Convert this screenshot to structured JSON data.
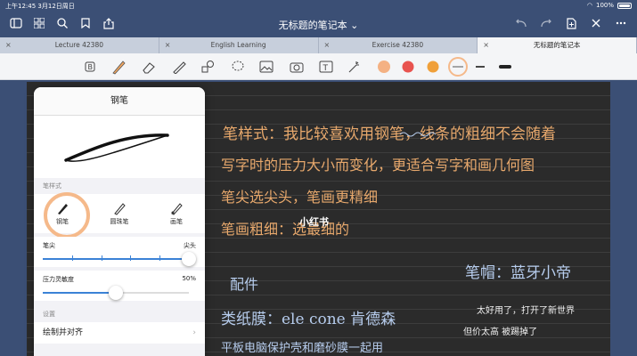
{
  "status": {
    "time": "上午12:45",
    "date": "3月12日周日",
    "battery": "100%"
  },
  "nav": {
    "title": "无标题的笔记本 ⌄"
  },
  "tabs": [
    {
      "label": "Lecture 42380"
    },
    {
      "label": "English Learning"
    },
    {
      "label": "Exercise 42380"
    },
    {
      "label": "无标题的笔记本"
    }
  ],
  "toolbar": {
    "colors": [
      "#f4b183",
      "#e8534f",
      "#f0a03a"
    ],
    "accent": "#f5b98a"
  },
  "panel": {
    "title": "钢笔",
    "style_label": "笔样式",
    "styles": [
      "钢笔",
      "圆珠笔",
      "画笔"
    ],
    "tip_label": "笔尖",
    "tip_value": "尖头",
    "pressure_label": "压力灵敏度",
    "pressure_value": "50%",
    "settings_label": "设置",
    "snap_label": "绘制并对齐"
  },
  "note": {
    "line1": "笔样式：我比较喜欢用钢笔，线条的粗细不会随着",
    "line2": "写字时的压力大小而变化，更适合写字和画几何图",
    "line3": "笔尖选尖头，笔画更精细",
    "line4": "笔画粗细：选最细的",
    "left_label": "配件",
    "right_label": "笔帽：蓝牙小帝",
    "film_line": "类纸膜：ele cone 肯德森",
    "right_small1": "太好用了，打开了新世界",
    "right_small2": "但价太高 被踢掉了",
    "bottom_line": "平板电脑保护壳和磨砂膜一起用"
  },
  "watermark": "小红书"
}
